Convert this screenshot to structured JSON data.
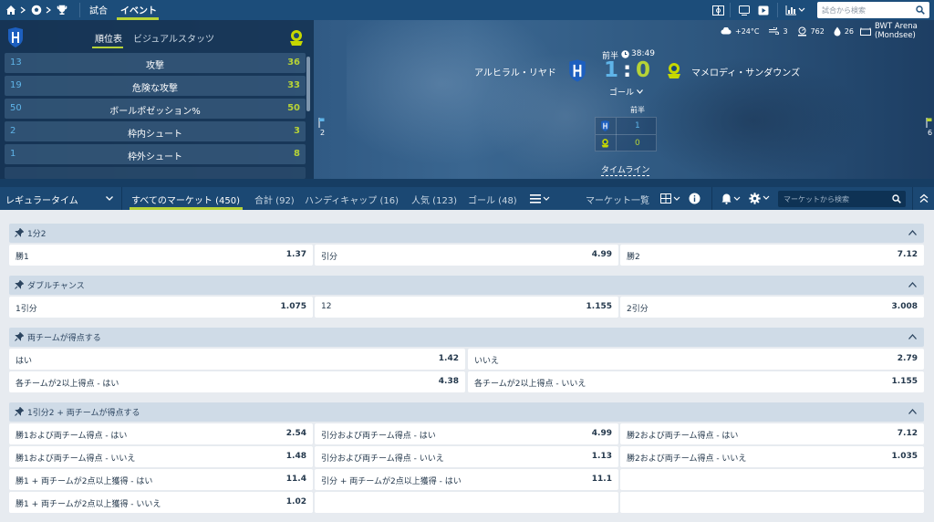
{
  "topnav": {
    "tab_matches": "試合",
    "tab_events": "イベント",
    "search_placeholder": "試合から検索"
  },
  "stats": {
    "tab_standings": "順位表",
    "tab_visual": "ビジュアルスタッツ",
    "rows": [
      {
        "home": "13",
        "label": "攻撃",
        "away": "36"
      },
      {
        "home": "19",
        "label": "危険な攻撃",
        "away": "33"
      },
      {
        "home": "50",
        "label": "ボールポゼッション%",
        "away": "50"
      },
      {
        "home": "2",
        "label": "枠内シュート",
        "away": "3"
      },
      {
        "home": "1",
        "label": "枠外シュート",
        "away": "8"
      }
    ]
  },
  "match": {
    "weather": "+24°C",
    "wind": "3",
    "pressure": "762",
    "humidity": "26",
    "venue": "BWT Arena (Mondsee)",
    "period": "前半",
    "clock": "38:49",
    "home_team": "アルヒラル・リヤド",
    "away_team": "マメロディ・サンダウンズ",
    "home_score": "1",
    "separator": ":",
    "away_score": "0",
    "goal_label": "ゴール",
    "table_header": "前半",
    "home_half": "1",
    "away_half": "0",
    "timeline_label": "タイムライン",
    "home_corners": "2",
    "away_corners": "6"
  },
  "marketbar": {
    "period_select": "レギュラータイム",
    "tabs": [
      {
        "label": "すべてのマーケット (450)"
      },
      {
        "label": "合計 (92)"
      },
      {
        "label": "ハンディキャップ (16)"
      },
      {
        "label": "人気 (123)"
      },
      {
        "label": "ゴール (48)"
      }
    ],
    "market_list": "マーケット一覧",
    "search_placeholder": "マーケットから検索"
  },
  "markets": [
    {
      "title": "1分2",
      "cells": [
        {
          "label": "勝1",
          "odd": "1.37"
        },
        {
          "label": "引分",
          "odd": "4.99"
        },
        {
          "label": "勝2",
          "odd": "7.12"
        }
      ]
    },
    {
      "title": "ダブルチャンス",
      "cells": [
        {
          "label": "1引分",
          "odd": "1.075"
        },
        {
          "label": "12",
          "odd": "1.155"
        },
        {
          "label": "2引分",
          "odd": "3.008"
        }
      ]
    },
    {
      "title": "両チームが得点する",
      "cells": [
        {
          "label": "はい",
          "odd": "1.42"
        },
        {
          "label": "いいえ",
          "odd": "2.79"
        },
        {
          "label": "各チームが2以上得点 - はい",
          "odd": "4.38"
        },
        {
          "label": "各チームが2以上得点 - いいえ",
          "odd": "1.155"
        }
      ]
    },
    {
      "title": "1引分2 + 両チームが得点する",
      "cells": [
        {
          "label": "勝1および両チーム得点 - はい",
          "odd": "2.54"
        },
        {
          "label": "引分および両チーム得点 - はい",
          "odd": "4.99"
        },
        {
          "label": "勝2および両チーム得点 - はい",
          "odd": "7.12"
        },
        {
          "label": "勝1および両チーム得点 - いいえ",
          "odd": "1.48"
        },
        {
          "label": "引分および両チーム得点 - いいえ",
          "odd": "1.13"
        },
        {
          "label": "勝2および両チーム得点 - いいえ",
          "odd": "1.035"
        },
        {
          "label": "勝1 + 両チームが2点以上獲得 - はい",
          "odd": "11.4"
        },
        {
          "label": "引分 + 両チームが2点以上獲得 - はい",
          "odd": "11.1"
        },
        {
          "label": "勝1 + 両チームが2点以上獲得 - いいえ",
          "odd": "1.02"
        }
      ]
    }
  ],
  "colors": {
    "accent": "#1c4d7a",
    "home_blue": "#5fb4e8",
    "away_green": "#b7d337"
  },
  "icons": [
    "home-icon",
    "soccer-ball-icon",
    "trophy-icon",
    "field-icon",
    "tv-icon",
    "video-icon",
    "chart-icon",
    "search-icon",
    "cloud-icon",
    "wind-icon",
    "pressure-icon",
    "drop-icon",
    "stadium-icon",
    "clock-icon",
    "list-icon",
    "grid-icon",
    "info-icon",
    "bell-icon",
    "gear-icon",
    "collapse-icon",
    "pin-icon",
    "chevron-up-icon"
  ]
}
